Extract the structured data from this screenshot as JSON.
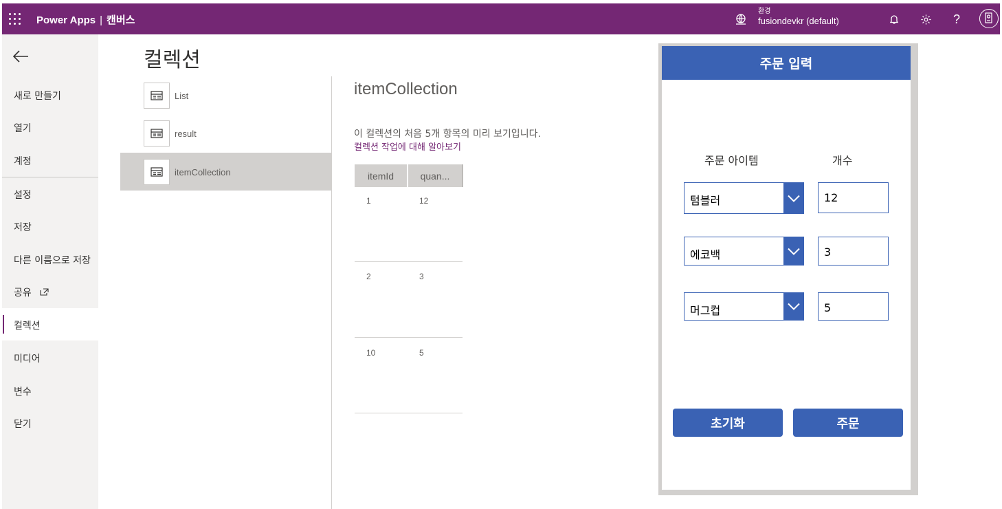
{
  "topbar": {
    "app_name": "Power Apps",
    "separator": "|",
    "section": "캔버스",
    "env_label": "환경",
    "env_value": "fusiondevkr (default)",
    "icons": [
      "waffle-icon",
      "environment-icon",
      "bell-icon",
      "gear-icon",
      "help-icon",
      "avatar-icon"
    ]
  },
  "nav": {
    "items": [
      {
        "label": "새로 만들기"
      },
      {
        "label": "열기"
      },
      {
        "label": "계정"
      },
      {
        "label": "설정"
      },
      {
        "label": "저장"
      },
      {
        "label": "다른 이름으로 저장"
      },
      {
        "label": "공유"
      },
      {
        "label": "컬렉션"
      },
      {
        "label": "미디어"
      },
      {
        "label": "변수"
      },
      {
        "label": "닫기"
      }
    ],
    "active": "컬렉션"
  },
  "page": {
    "title": "컬렉션",
    "collections": [
      {
        "name": "List"
      },
      {
        "name": "result"
      },
      {
        "name": "itemCollection"
      }
    ],
    "selected": "itemCollection"
  },
  "detail": {
    "title": "itemCollection",
    "preview_text": "이 컬렉션의 처음 5개 항목의 미리 보기입니다.",
    "learn_link": "컬렉션 작업에 대해 알아보기",
    "columns": [
      "itemId",
      "quan..."
    ],
    "rows": [
      [
        "1",
        "12"
      ],
      [
        "2",
        "3"
      ],
      [
        "10",
        "5"
      ]
    ]
  },
  "app": {
    "header": "주문 입력",
    "col_item": "주문 아이템",
    "col_count": "개수",
    "rows": [
      {
        "item": "텀블러",
        "count": "12"
      },
      {
        "item": "에코백",
        "count": "3"
      },
      {
        "item": "머그컵",
        "count": "5"
      }
    ],
    "reset_label": "초기화",
    "order_label": "주문",
    "accent_color": "#3a62b4"
  },
  "colors": {
    "brand": "#742774",
    "nav_bg": "#f3f2f1",
    "selected_bg": "#d2d0ce"
  }
}
